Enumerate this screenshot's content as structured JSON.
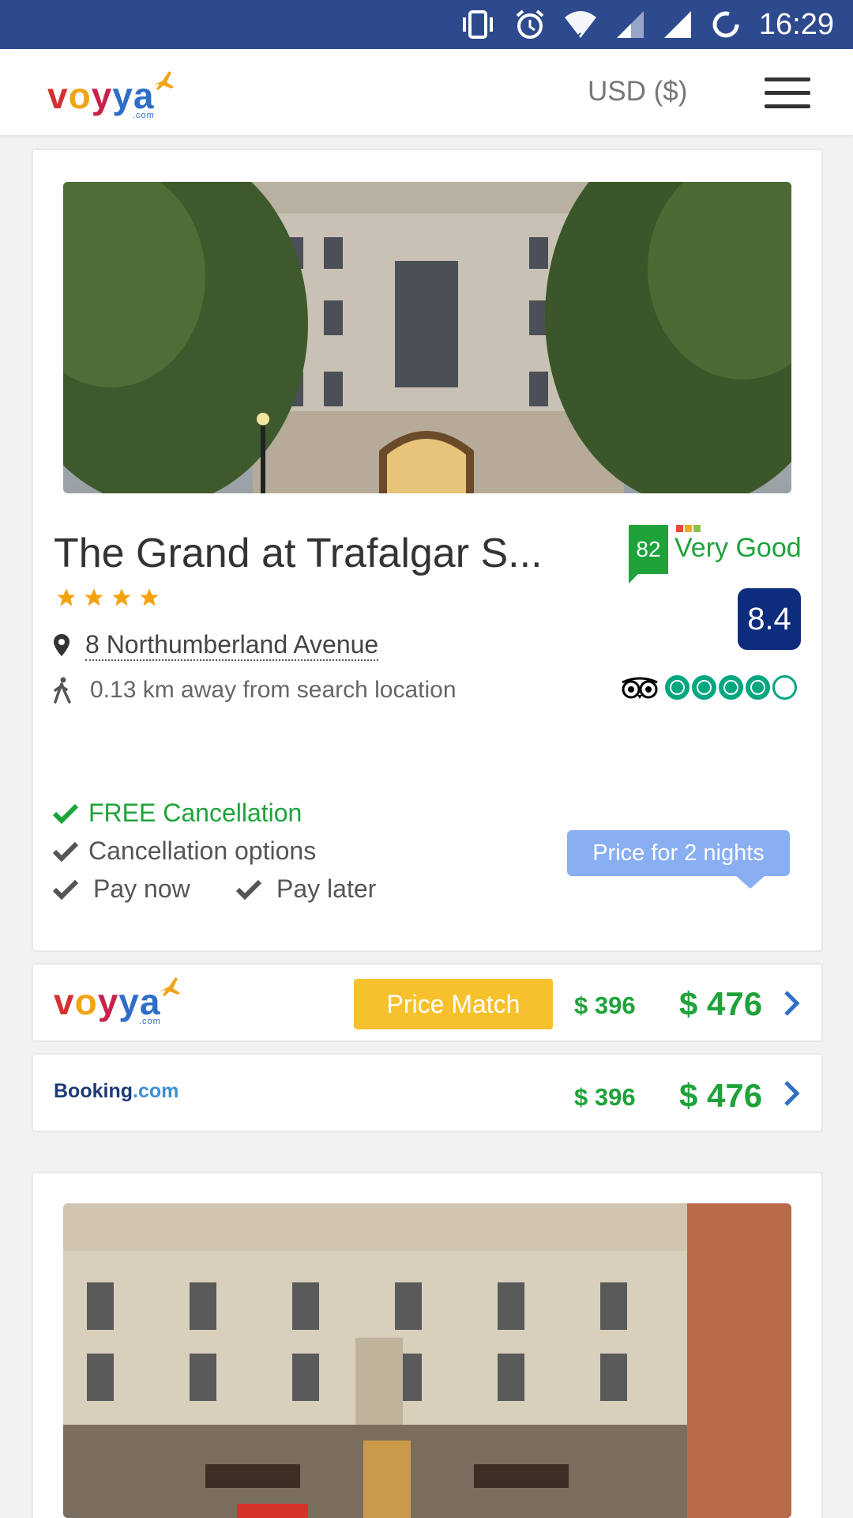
{
  "status_bar": {
    "time": "16:29",
    "icons": [
      "vibrate-icon",
      "alarm-icon",
      "wifi-icon",
      "signal-icon",
      "signal-icon",
      "loading-icon"
    ]
  },
  "header": {
    "logo": {
      "main": "voyya",
      "suffix": ".com"
    },
    "currency": "USD ($)",
    "menu_icon": "hamburger-icon"
  },
  "hotel": {
    "name": "The Grand at Trafalgar S...",
    "stars": 4,
    "address": "8 Northumberland Avenue",
    "distance": "0.13 km away from search location",
    "score": "82",
    "score_label": "Very Good",
    "rating": "8.4",
    "tripadvisor_rating": 4,
    "tripadvisor_max": 5,
    "features": {
      "free_cancellation": "FREE Cancellation",
      "cancellation_options": "Cancellation options",
      "pay_now": "Pay now",
      "pay_later": "Pay later"
    },
    "price_tooltip": "Price for 2 nights"
  },
  "offers": [
    {
      "provider": "voyya",
      "provider_suffix": ".com",
      "badge": "Price Match",
      "old_price": "$ 396",
      "price": "$ 476"
    },
    {
      "provider": "Booking",
      "provider_suffix": ".com",
      "old_price": "$ 396",
      "price": "$ 476"
    }
  ],
  "colors": {
    "status_bar": "#2e4a8e",
    "green": "#1ea33a",
    "rating_box": "#0d2c7e",
    "tooltip": "#8aaef2",
    "price_match": "#f6c12c",
    "tripadvisor": "#00a680"
  }
}
